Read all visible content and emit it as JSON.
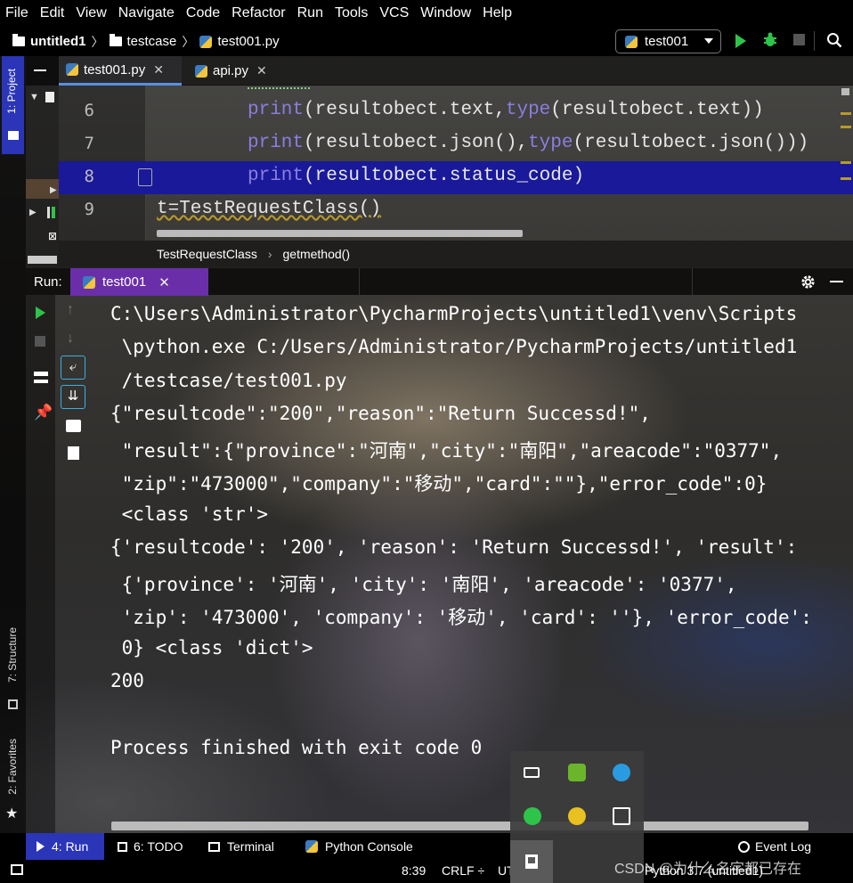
{
  "menubar": {
    "items": [
      "File",
      "Edit",
      "View",
      "Navigate",
      "Code",
      "Refactor",
      "Run",
      "Tools",
      "VCS",
      "Window",
      "Help"
    ]
  },
  "navbar": {
    "project": "untitled1",
    "folder": "testcase",
    "file": "test001.py",
    "run_config": "test001"
  },
  "left_strip": {
    "project_tab": "1: Project",
    "structure_tab": "7: Structure",
    "favorites_tab": "2: Favorites"
  },
  "editor": {
    "tabs": [
      {
        "label": "test001.py",
        "active": true
      },
      {
        "label": "api.py",
        "active": false
      }
    ],
    "lines": [
      {
        "num": "6",
        "kw1": "print",
        "a": "(resultobect.text",
        "comma": ",",
        "kw2": "type",
        "b": "(resultobect.text))"
      },
      {
        "num": "7",
        "kw1": "print",
        "a": "(resultobect.json()",
        "comma": ",",
        "kw2": "type",
        "b": "(resultobect.json()))"
      },
      {
        "num": "8",
        "kw1": "print",
        "a": "(resultobect.status_code)",
        "comma": "",
        "kw2": "",
        "b": ""
      },
      {
        "num": "9",
        "kw1": "",
        "a": "t=TestRequestClass()",
        "comma": "",
        "kw2": "",
        "b": ""
      }
    ],
    "breadcrumb": [
      "TestRequestClass",
      "getmethod()"
    ]
  },
  "run": {
    "label": "Run:",
    "tab": "test001"
  },
  "console": {
    "lines": [
      "C:\\Users\\Administrator\\PycharmProjects\\untitled1\\venv\\Scripts",
      " \\python.exe C:/Users/Administrator/PycharmProjects/untitled1",
      " /testcase/test001.py",
      "{\"resultcode\":\"200\",\"reason\":\"Return Successd!\",",
      " \"result\":{\"province\":\"河南\",\"city\":\"南阳\",\"areacode\":\"0377\",",
      " \"zip\":\"473000\",\"company\":\"移动\",\"card\":\"\"},\"error_code\":0}",
      " <class 'str'>",
      "{'resultcode': '200', 'reason': 'Return Successd!', 'result':",
      " {'province': '河南', 'city': '南阳', 'areacode': '0377',",
      " 'zip': '473000', 'company': '移动', 'card': ''}, 'error_code':",
      " 0} <class 'dict'>",
      "200",
      "",
      "Process finished with exit code 0"
    ]
  },
  "bottom_tabs": {
    "run": "4: Run",
    "todo": "6: TODO",
    "terminal": "Terminal",
    "python_console": "Python Console",
    "event_log": "Event Log"
  },
  "statusbar": {
    "position": "8:39",
    "line_sep": "CRLF ÷",
    "encoding": "UT",
    "interpreter": "Python 3.7 (untitled1)"
  },
  "watermark": "CSDN @为什么名字都已存在",
  "colors": {
    "accent_blue": "#2a35b8",
    "run_tab_purple": "#6a2fa8",
    "keyword_purple": "#8a7ee0",
    "run_green": "#2ec44a",
    "highlight_line": "#19199a"
  }
}
